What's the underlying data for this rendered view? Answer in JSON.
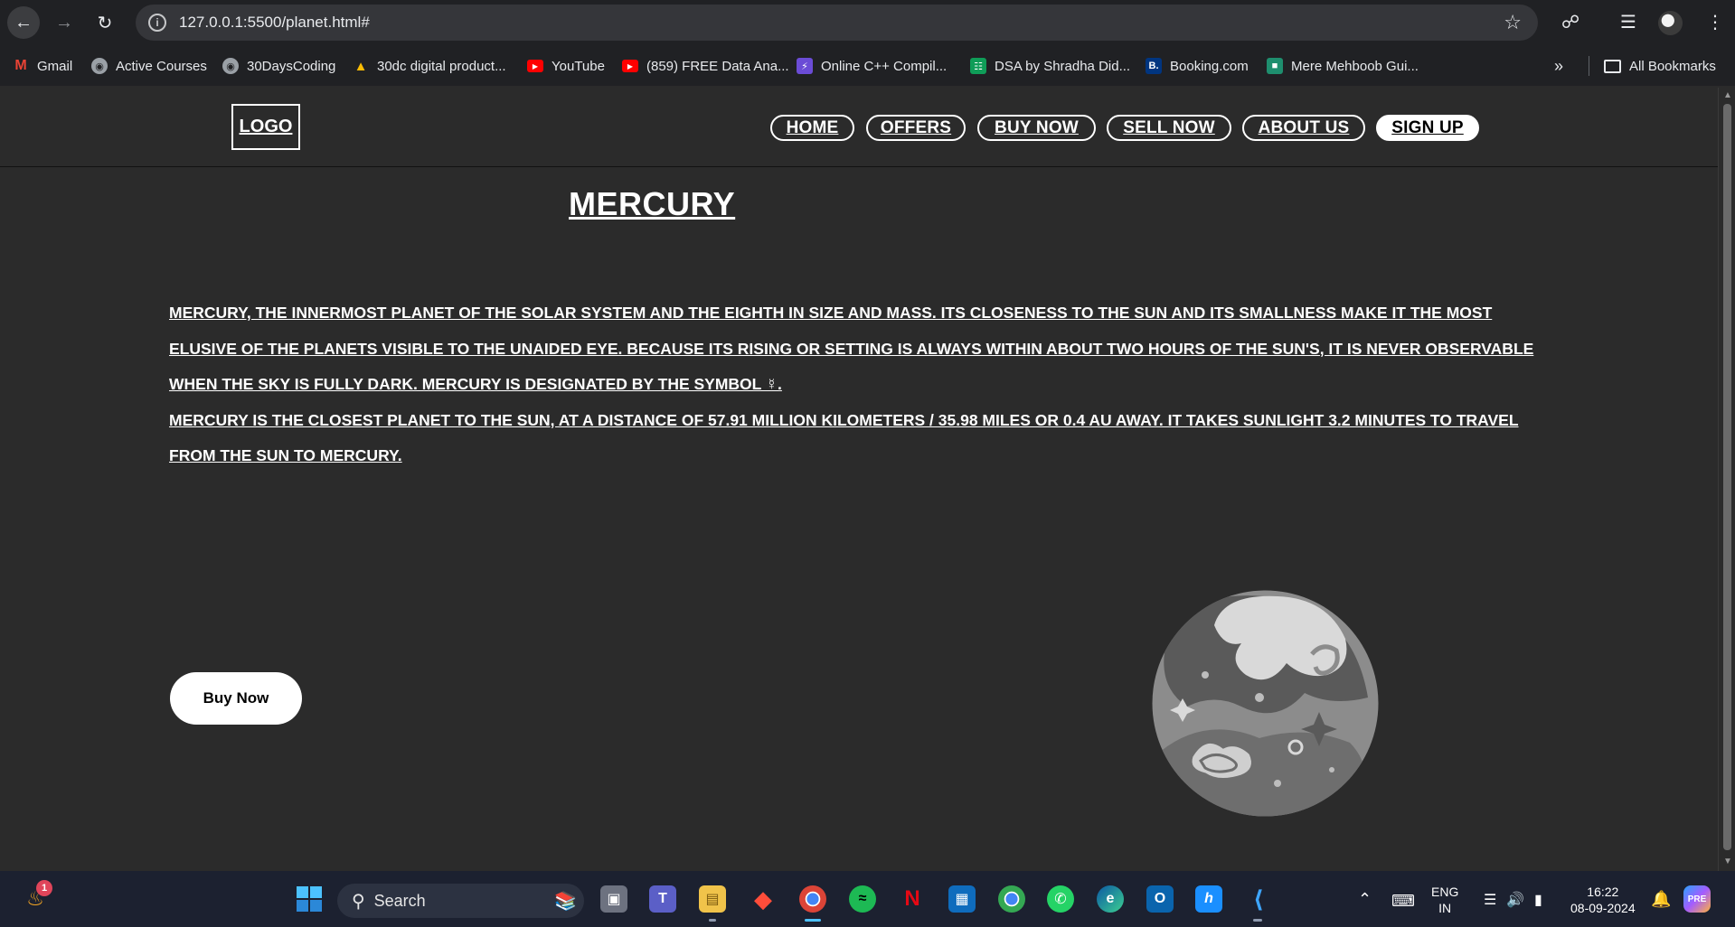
{
  "browser": {
    "url": "127.0.0.1:5500/planet.html#",
    "bookmarks": [
      {
        "label": "Gmail",
        "icon": "gmail-icon",
        "color": "#ea4335"
      },
      {
        "label": "Active Courses",
        "icon": "globe-icon",
        "color": "#9aa0a6"
      },
      {
        "label": "30DaysCoding",
        "icon": "globe-icon",
        "color": "#9aa0a6"
      },
      {
        "label": "30dc digital product...",
        "icon": "drive-icon",
        "color": "#fbbc04"
      },
      {
        "label": "YouTube",
        "icon": "youtube-icon",
        "color": "#ff0000"
      },
      {
        "label": "(859) FREE Data Ana...",
        "icon": "youtube-icon",
        "color": "#ff0000"
      },
      {
        "label": "Online C++ Compil...",
        "icon": "bolt-icon",
        "color": "#6b4cd6"
      },
      {
        "label": "DSA by Shradha Did...",
        "icon": "sheets-icon",
        "color": "#0f9d58"
      },
      {
        "label": "Booking.com",
        "icon": "booking-icon",
        "color": "#003580"
      },
      {
        "label": "Mere Mehboob Gui...",
        "icon": "app-icon",
        "color": "#1e8e6e"
      }
    ],
    "all_bookmarks": "All Bookmarks"
  },
  "site": {
    "logo": "LOGO",
    "nav": [
      "HOME",
      "OFFERS",
      "BUY NOW",
      "SELL NOW",
      "ABOUT US",
      "SIGN UP"
    ],
    "title": "MERCURY",
    "paragraph1": "MERCURY, THE INNERMOST PLANET OF THE SOLAR SYSTEM AND THE EIGHTH IN SIZE AND MASS. ITS CLOSENESS TO THE SUN AND ITS SMALLNESS MAKE IT THE MOST ELUSIVE OF THE PLANETS VISIBLE TO THE UNAIDED EYE. BECAUSE ITS RISING OR SETTING IS ALWAYS WITHIN ABOUT TWO HOURS OF THE SUN'S, IT IS NEVER OBSERVABLE WHEN THE SKY IS FULLY DARK. MERCURY IS DESIGNATED BY THE SYMBOL ☿.",
    "paragraph2": "MERCURY IS THE CLOSEST PLANET TO THE SUN, AT A DISTANCE OF 57.91 MILLION KILOMETERS / 35.98 MILES OR 0.4 AU AWAY. IT TAKES SUNLIGHT 3.2 MINUTES TO TRAVEL FROM THE SUN TO MERCURY.",
    "buy_button": "Buy Now"
  },
  "taskbar": {
    "search_label": "Search",
    "notification_count": "1",
    "lang_top": "ENG",
    "lang_bottom": "IN",
    "time": "16:22",
    "date": "08-09-2024"
  }
}
